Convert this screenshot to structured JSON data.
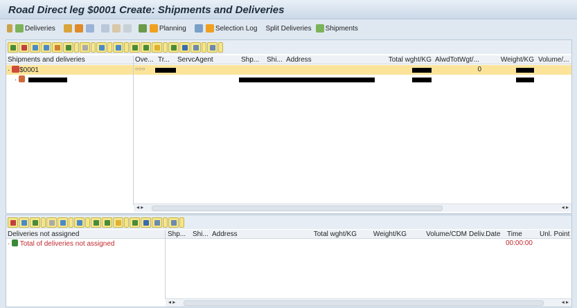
{
  "window": {
    "title": "Road Direct leg $0001 Create: Shipments and Deliveries"
  },
  "toolbar": {
    "items": [
      {
        "label": "Deliveries",
        "icon": "deliveries-icon"
      },
      {
        "label": "Planning",
        "icon": "planning-icon"
      },
      {
        "label": "Selection Log",
        "icon": "log-icon"
      },
      {
        "label": "Split Deliveries",
        "icon": ""
      },
      {
        "label": "Shipments",
        "icon": "shipments-icon"
      }
    ]
  },
  "upper": {
    "columns": [
      "Shipments and deliveries",
      "Ove...",
      "Tr...",
      "ServcAgent",
      "Shp...",
      "Shi...",
      "Address",
      "Total wght/KG",
      "AlwdTotWgt/...",
      "Weight/KG",
      "Volume/..."
    ],
    "rows": [
      {
        "node": "$0001",
        "alwd": "0",
        "selected": true
      },
      {
        "node": "",
        "selected": false
      }
    ]
  },
  "lower": {
    "columns": [
      "Deliveries not assigned",
      "Shp...",
      "Shi...",
      "Address",
      "Total wght/KG",
      "Weight/KG",
      "Volume/CDM",
      "Deliv.Date",
      "Time",
      "Unl. Point"
    ],
    "rows": [
      {
        "node": "Total of deliveries not assigned",
        "time": "00:00:00"
      }
    ]
  },
  "colors": {
    "selected_row": "#fbe49a",
    "alert_text": "#c0282d",
    "title_bg": "#c9d8e8"
  }
}
